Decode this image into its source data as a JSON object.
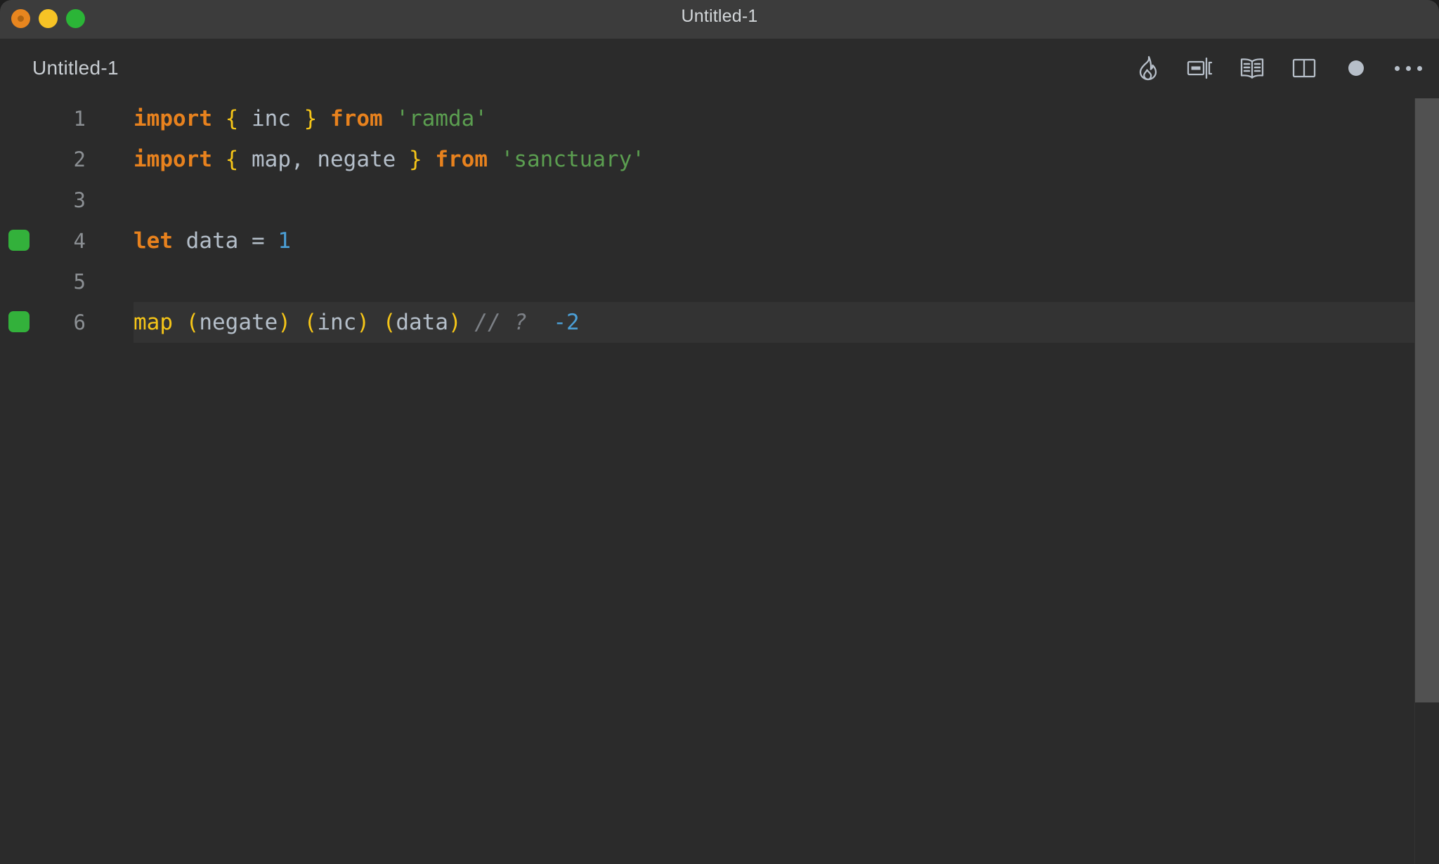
{
  "window": {
    "title": "Untitled-1",
    "traffic_lights": [
      {
        "name": "close",
        "color": "#e8861f"
      },
      {
        "name": "minimize",
        "color": "#f7c325"
      },
      {
        "name": "maximize",
        "color": "#2bb537"
      }
    ]
  },
  "tabbar": {
    "tab_label": "Untitled-1",
    "toolbar_icons": [
      {
        "name": "flame-icon",
        "label": "Quokka / Run"
      },
      {
        "name": "split-terminal-icon",
        "label": "Open Console"
      },
      {
        "name": "open-book-icon",
        "label": "Open Preview"
      },
      {
        "name": "split-editor-icon",
        "label": "Split Editor"
      },
      {
        "name": "dot-icon",
        "label": "Unsaved Indicator"
      },
      {
        "name": "ellipsis-icon",
        "label": "More Actions"
      }
    ]
  },
  "editor": {
    "language": "javascript",
    "lines": [
      {
        "number": "1",
        "marker": false,
        "active": false,
        "tokens": [
          {
            "t": "import",
            "c": "k-kw"
          },
          {
            "t": " ",
            "c": "k-punct"
          },
          {
            "t": "{",
            "c": "k-brace"
          },
          {
            "t": " ",
            "c": "k-punct"
          },
          {
            "t": "inc",
            "c": "k-ident"
          },
          {
            "t": " ",
            "c": "k-punct"
          },
          {
            "t": "}",
            "c": "k-brace"
          },
          {
            "t": " ",
            "c": "k-punct"
          },
          {
            "t": "from",
            "c": "k-kw"
          },
          {
            "t": " ",
            "c": "k-punct"
          },
          {
            "t": "'ramda'",
            "c": "k-str"
          }
        ]
      },
      {
        "number": "2",
        "marker": false,
        "active": false,
        "tokens": [
          {
            "t": "import",
            "c": "k-kw"
          },
          {
            "t": " ",
            "c": "k-punct"
          },
          {
            "t": "{",
            "c": "k-brace"
          },
          {
            "t": " ",
            "c": "k-punct"
          },
          {
            "t": "map",
            "c": "k-ident"
          },
          {
            "t": ",",
            "c": "k-punct"
          },
          {
            "t": " ",
            "c": "k-punct"
          },
          {
            "t": "negate",
            "c": "k-ident"
          },
          {
            "t": " ",
            "c": "k-punct"
          },
          {
            "t": "}",
            "c": "k-brace"
          },
          {
            "t": " ",
            "c": "k-punct"
          },
          {
            "t": "from",
            "c": "k-kw"
          },
          {
            "t": " ",
            "c": "k-punct"
          },
          {
            "t": "'sanctuary'",
            "c": "k-str"
          }
        ]
      },
      {
        "number": "3",
        "marker": false,
        "active": false,
        "tokens": []
      },
      {
        "number": "4",
        "marker": true,
        "active": false,
        "tokens": [
          {
            "t": "let",
            "c": "k-kw"
          },
          {
            "t": " ",
            "c": "k-punct"
          },
          {
            "t": "data",
            "c": "k-ident"
          },
          {
            "t": " ",
            "c": "k-punct"
          },
          {
            "t": "=",
            "c": "k-op"
          },
          {
            "t": " ",
            "c": "k-punct"
          },
          {
            "t": "1",
            "c": "k-num"
          }
        ]
      },
      {
        "number": "5",
        "marker": false,
        "active": false,
        "tokens": []
      },
      {
        "number": "6",
        "marker": true,
        "active": true,
        "tokens": [
          {
            "t": "map",
            "c": "k-fn"
          },
          {
            "t": " ",
            "c": "k-punct"
          },
          {
            "t": "(",
            "c": "k-paren"
          },
          {
            "t": "negate",
            "c": "k-ident"
          },
          {
            "t": ")",
            "c": "k-paren"
          },
          {
            "t": " ",
            "c": "k-punct"
          },
          {
            "t": "(",
            "c": "k-paren"
          },
          {
            "t": "inc",
            "c": "k-ident"
          },
          {
            "t": ")",
            "c": "k-paren"
          },
          {
            "t": " ",
            "c": "k-punct"
          },
          {
            "t": "(",
            "c": "k-paren"
          },
          {
            "t": "data",
            "c": "k-ident"
          },
          {
            "t": ")",
            "c": "k-paren"
          },
          {
            "t": " ",
            "c": "k-punct"
          },
          {
            "t": "//",
            "c": "k-comment"
          },
          {
            "t": " ",
            "c": "k-punct"
          },
          {
            "t": "?",
            "c": "k-comment"
          },
          {
            "t": "  ",
            "c": "k-punct"
          },
          {
            "t": "-2",
            "c": "k-result"
          }
        ]
      }
    ]
  },
  "scrollbar": {
    "name": "vertical-scrollbar",
    "thumb_color": "#515151"
  },
  "colors": {
    "titlebar_bg": "#3c3c3c",
    "editor_bg": "#2b2b2b",
    "active_line_bg": "#333333",
    "breakpoint_green": "#33b13b",
    "keyword_orange": "#e8821e",
    "brace_yellow": "#f5c518",
    "string_green": "#5b9e50",
    "number_blue": "#4b9fd6",
    "identifier_gray": "#b5bfca",
    "comment_gray": "#7c8086"
  }
}
